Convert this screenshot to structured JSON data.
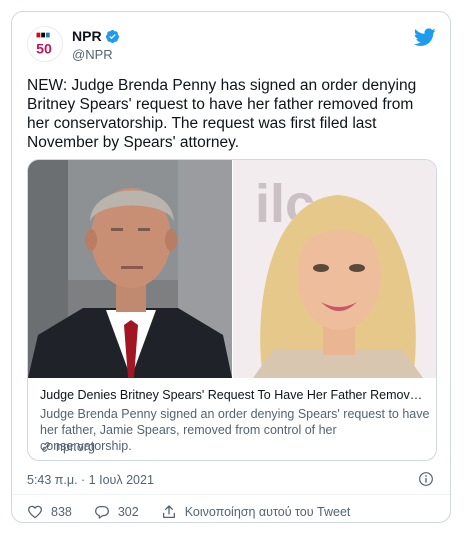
{
  "account": {
    "name": "NPR",
    "handle": "@NPR",
    "avatar_text": "50"
  },
  "tweet": {
    "text": "NEW: Judge Brenda Penny has signed an order denying Britney Spears' request to have her father removed from her conservatorship. The request was first filed last November by Spears' attorney."
  },
  "link_card": {
    "title": "Judge Denies Britney Spears' Request To Have Her Father Removed Fro…",
    "description": "Judge Brenda Penny signed an order denying Spears' request to have her father, Jamie Spears, removed from control of her conservatorship.",
    "domain": "npr.org",
    "right_image_text": "ilc"
  },
  "meta": {
    "timestamp": "5:43 π.μ. · 1 Ιουλ 2021"
  },
  "actions": {
    "likes": "838",
    "replies": "302",
    "share_label": "Κοινοποίηση αυτού του Tweet"
  },
  "colors": {
    "twitter_blue": "#1d9bf0",
    "secondary_text": "#536471",
    "border": "#cfd9de"
  }
}
